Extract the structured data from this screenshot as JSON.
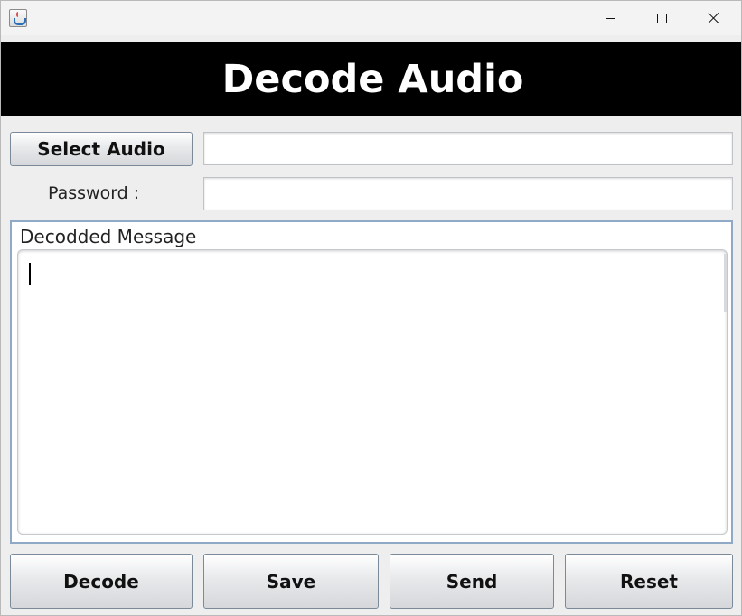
{
  "window": {
    "minimize_icon": "minimize-icon",
    "maximize_icon": "maximize-icon",
    "close_icon": "close-icon",
    "app_icon": "java-cup-icon"
  },
  "header": {
    "title": "Decode Audio",
    "background": "#000000",
    "color": "#ffffff"
  },
  "form": {
    "select_audio_label": "Select Audio",
    "audio_path_value": "",
    "password_label": "Password :",
    "password_value": ""
  },
  "message": {
    "title": "Decodded Message",
    "value": ""
  },
  "actions": {
    "decode_label": "Decode",
    "save_label": "Save",
    "send_label": "Send",
    "reset_label": "Reset"
  }
}
